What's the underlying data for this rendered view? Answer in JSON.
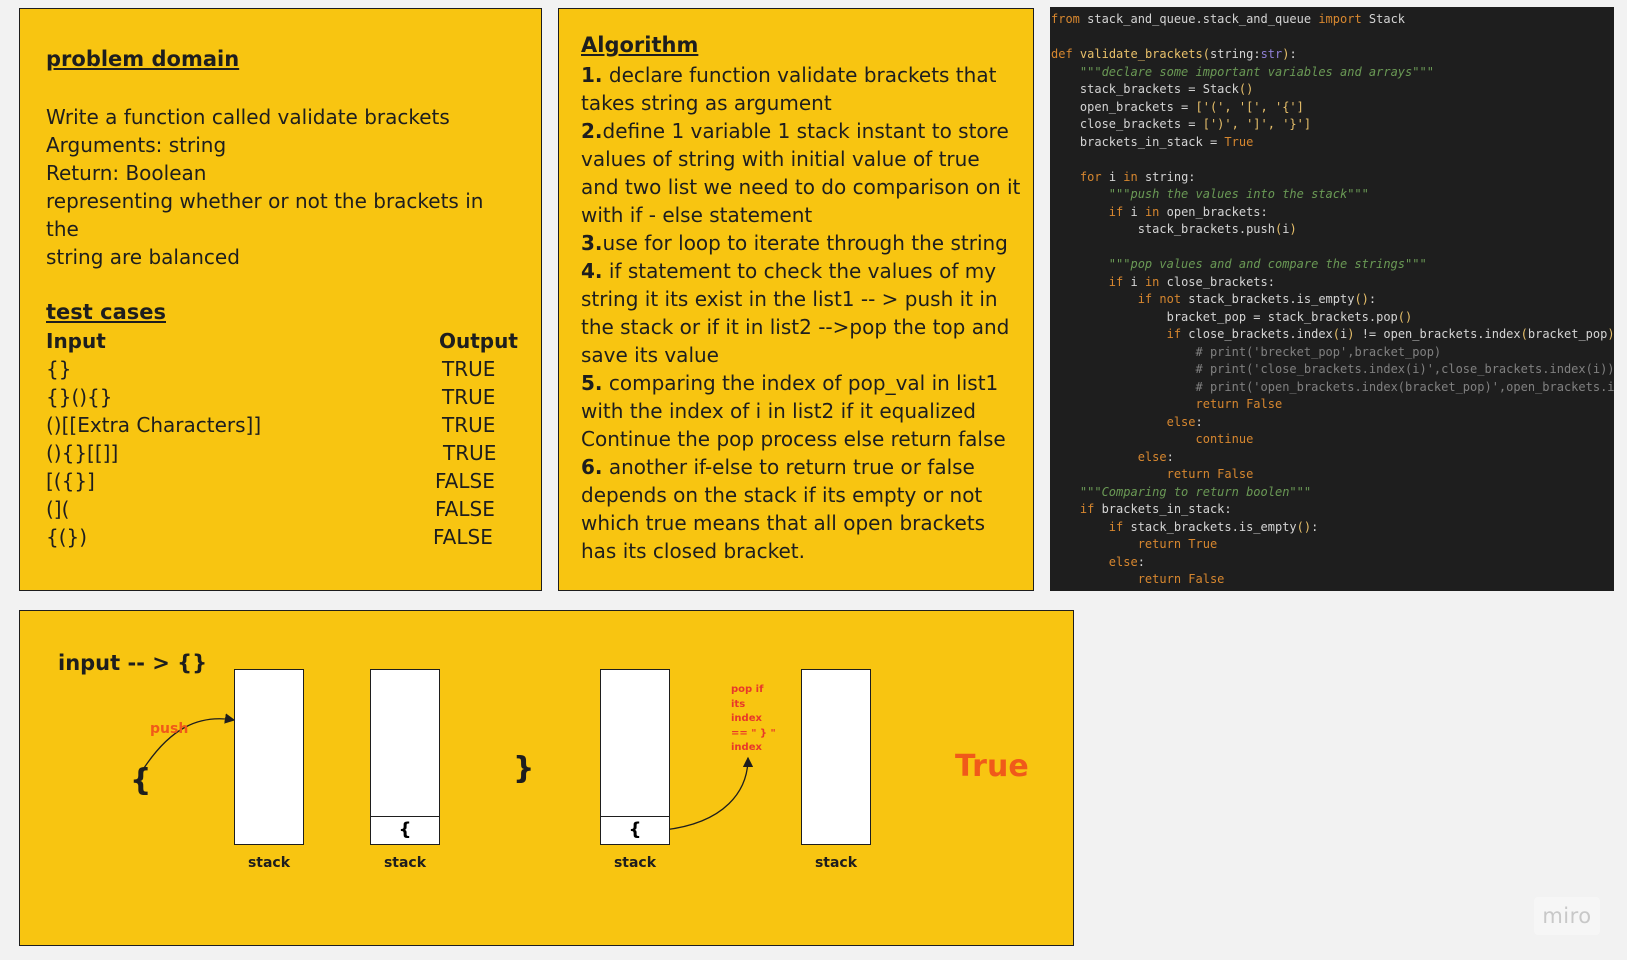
{
  "problem": {
    "title": "problem domain",
    "lines": [
      "Write a function called validate brackets",
      "Arguments: string",
      "Return: Boolean",
      "representing whether or not the brackets in the",
      "string are balanced"
    ]
  },
  "tests": {
    "title": "test cases",
    "input_header": "Input",
    "output_header": "Output",
    "rows": [
      {
        "input": "{}",
        "output": "TRUE"
      },
      {
        "input": "{}(){}",
        "output": "TRUE"
      },
      {
        "input": "()[[Extra Characters]]",
        "output": "TRUE"
      },
      {
        "input": "(){}[[]]",
        "output": "TRUE"
      },
      {
        "input": "[({}]",
        "output": "FALSE"
      },
      {
        "input": "(](",
        "output": "FALSE"
      },
      {
        "input": "{(})",
        "output": "FALSE"
      }
    ]
  },
  "algorithm": {
    "title": "Algorithm",
    "steps": [
      {
        "num": "1.",
        "text": " declare function validate brackets that takes string as argument"
      },
      {
        "num": "2.",
        "text": "define 1 variable 1 stack instant to store values of string with initial value of true and two list we need to do comparison on it with if - else statement"
      },
      {
        "num": "3.",
        "text": "use for loop to iterate through the string"
      },
      {
        "num": "4.",
        "text": " if statement to check the values of my string it its exist in the list1 -- > push it in the stack or if it in list2 -->pop the top and save its value"
      },
      {
        "num": "5.",
        "text": " comparing the index of pop_val in list1 with the index of  i in list2 if it equalized Continue the pop process else return false"
      },
      {
        "num": "6.",
        "text": " another if-else to return true or false depends on the stack if its empty or not which true means that all open brackets has its closed bracket."
      }
    ]
  },
  "code": {
    "lines": [
      [
        [
          "kw",
          "from"
        ],
        [
          "pl",
          " stack_and_queue.stack_and_queue "
        ],
        [
          "kw",
          "import"
        ],
        [
          "pl",
          " Stack"
        ]
      ],
      [],
      [
        [
          "kw",
          "def"
        ],
        [
          "pl",
          " "
        ],
        [
          "fn",
          "validate_brackets"
        ],
        [
          "str",
          "("
        ],
        [
          "pl",
          "string:"
        ],
        [
          "bi",
          "str"
        ],
        [
          "str",
          ")"
        ],
        [
          "pl",
          ":"
        ]
      ],
      [
        [
          "pl",
          "    "
        ],
        [
          "doc",
          "\"\"\"declare some important variables and arrays\"\"\""
        ]
      ],
      [
        [
          "pl",
          "    stack_brackets = Stack"
        ],
        [
          "str",
          "()"
        ]
      ],
      [
        [
          "pl",
          "    open_brackets = "
        ],
        [
          "str",
          "['(', '[', '{']"
        ]
      ],
      [
        [
          "pl",
          "    close_brackets = "
        ],
        [
          "str",
          "[')', ']', '}']"
        ]
      ],
      [
        [
          "pl",
          "    brackets_in_stack = "
        ],
        [
          "kw",
          "True"
        ]
      ],
      [],
      [
        [
          "pl",
          "    "
        ],
        [
          "kw",
          "for"
        ],
        [
          "pl",
          " i "
        ],
        [
          "kw",
          "in"
        ],
        [
          "pl",
          " string:"
        ]
      ],
      [
        [
          "pl",
          "        "
        ],
        [
          "doc",
          "\"\"\"push the values into the stack\"\"\""
        ]
      ],
      [
        [
          "pl",
          "        "
        ],
        [
          "kw",
          "if"
        ],
        [
          "pl",
          " i "
        ],
        [
          "kw",
          "in"
        ],
        [
          "pl",
          " open_brackets:"
        ]
      ],
      [
        [
          "pl",
          "            stack_brackets.push"
        ],
        [
          "str",
          "("
        ],
        [
          "pl",
          "i"
        ],
        [
          "str",
          ")"
        ]
      ],
      [],
      [
        [
          "pl",
          "        "
        ],
        [
          "doc",
          "\"\"\"pop values and and compare the strings\"\"\""
        ]
      ],
      [
        [
          "pl",
          "        "
        ],
        [
          "kw",
          "if"
        ],
        [
          "pl",
          " i "
        ],
        [
          "kw",
          "in"
        ],
        [
          "pl",
          " close_brackets:"
        ]
      ],
      [
        [
          "pl",
          "            "
        ],
        [
          "kw",
          "if not"
        ],
        [
          "pl",
          " stack_brackets.is_empty"
        ],
        [
          "str",
          "()"
        ],
        [
          "pl",
          ":"
        ]
      ],
      [
        [
          "pl",
          "                bracket_pop = stack_brackets.pop"
        ],
        [
          "str",
          "()"
        ]
      ],
      [
        [
          "pl",
          "                "
        ],
        [
          "kw",
          "if"
        ],
        [
          "pl",
          " close_brackets.index"
        ],
        [
          "str",
          "("
        ],
        [
          "pl",
          "i"
        ],
        [
          "str",
          ")"
        ],
        [
          "pl",
          " != open_brackets.index"
        ],
        [
          "str",
          "("
        ],
        [
          "pl",
          "bracket_pop"
        ],
        [
          "str",
          ")"
        ],
        [
          "pl",
          ":"
        ]
      ],
      [
        [
          "pl",
          "                    "
        ],
        [
          "cm",
          "# print('brecket_pop',bracket_pop)"
        ]
      ],
      [
        [
          "pl",
          "                    "
        ],
        [
          "cm",
          "# print('close_brackets.index(i)',close_brackets.index(i))"
        ]
      ],
      [
        [
          "pl",
          "                    "
        ],
        [
          "cm",
          "# print('open_brackets.index(bracket_pop)',open_brackets.in"
        ]
      ],
      [
        [
          "pl",
          "                    "
        ],
        [
          "kw",
          "return False"
        ]
      ],
      [
        [
          "pl",
          "                "
        ],
        [
          "kw",
          "else"
        ],
        [
          "pl",
          ":"
        ]
      ],
      [
        [
          "pl",
          "                    "
        ],
        [
          "kw",
          "continue"
        ]
      ],
      [
        [
          "pl",
          "            "
        ],
        [
          "kw",
          "else"
        ],
        [
          "pl",
          ":"
        ]
      ],
      [
        [
          "pl",
          "                "
        ],
        [
          "kw",
          "return False"
        ]
      ],
      [
        [
          "pl",
          "    "
        ],
        [
          "doc",
          "\"\"\"Comparing to return boolen\"\"\""
        ]
      ],
      [
        [
          "pl",
          "    "
        ],
        [
          "kw",
          "if"
        ],
        [
          "pl",
          " brackets_in_stack:"
        ]
      ],
      [
        [
          "pl",
          "        "
        ],
        [
          "kw",
          "if"
        ],
        [
          "pl",
          " stack_brackets.is_empty"
        ],
        [
          "str",
          "()"
        ],
        [
          "pl",
          ":"
        ]
      ],
      [
        [
          "pl",
          "            "
        ],
        [
          "kw",
          "return True"
        ]
      ],
      [
        [
          "pl",
          "        "
        ],
        [
          "kw",
          "else"
        ],
        [
          "pl",
          ":"
        ]
      ],
      [
        [
          "pl",
          "            "
        ],
        [
          "kw",
          "return False"
        ]
      ]
    ]
  },
  "diagram": {
    "input_label": "input  -- >  {}",
    "push_label": "push",
    "open_bracket": "{",
    "close_bracket": "}",
    "stack_label": "stack",
    "stack_item": "{",
    "pop_label_lines": [
      "pop if",
      "its",
      "index",
      "== \" } \"",
      "index"
    ],
    "result": "True"
  },
  "branding": {
    "logo": "miro"
  },
  "colors": {
    "card_bg": "#f8c511",
    "code_bg": "#1e1e1e",
    "result_orange": "#f05a1a",
    "pop_red": "#e8382a"
  }
}
